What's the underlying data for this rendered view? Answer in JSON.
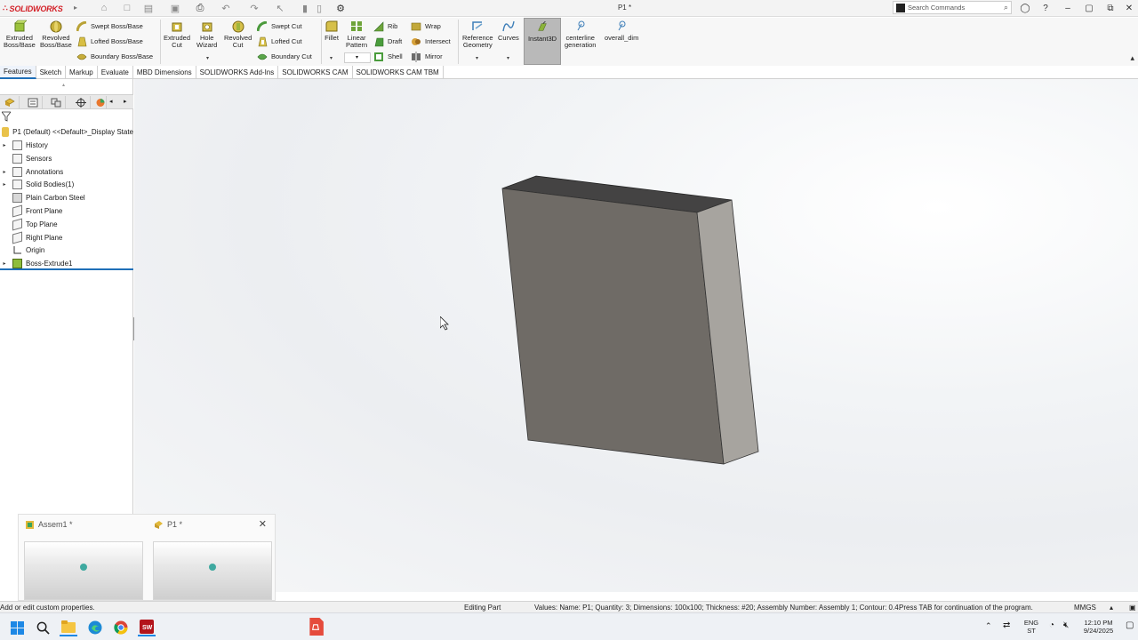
{
  "titlebar": {
    "app_name": "SOLIDWORKS",
    "doc_title": "P1 *",
    "search_placeholder": "Search Commands"
  },
  "ribbon": {
    "extruded_boss": "Extruded\nBoss/Base",
    "revolved_boss": "Revolved\nBoss/Base",
    "swept_boss": "Swept Boss/Base",
    "lofted_boss": "Lofted Boss/Base",
    "boundary_boss": "Boundary Boss/Base",
    "extruded_cut": "Extruded\nCut",
    "hole_wizard": "Hole\nWizard",
    "revolved_cut": "Revolved\nCut",
    "swept_cut": "Swept Cut",
    "lofted_cut": "Lofted Cut",
    "boundary_cut": "Boundary Cut",
    "fillet": "Fillet",
    "linear_pattern": "Linear\nPattern",
    "rib": "Rib",
    "draft": "Draft",
    "shell": "Shell",
    "wrap": "Wrap",
    "intersect": "Intersect",
    "mirror": "Mirror",
    "reference_geometry": "Reference\nGeometry",
    "curves": "Curves",
    "instant3d": "Instant3D",
    "centerline_generation": "centerline\ngeneration",
    "overall_dim": "overall_dim"
  },
  "tabs": [
    "Features",
    "Sketch",
    "Markup",
    "Evaluate",
    "MBD Dimensions",
    "SOLIDWORKS Add-Ins",
    "SOLIDWORKS CAM",
    "SOLIDWORKS CAM TBM"
  ],
  "tree": {
    "root": "P1 (Default) <<Default>_Display State",
    "items": [
      {
        "label": "History",
        "expandable": true
      },
      {
        "label": "Sensors",
        "expandable": false
      },
      {
        "label": "Annotations",
        "expandable": true
      },
      {
        "label": "Solid Bodies(1)",
        "expandable": true
      },
      {
        "label": "Plain Carbon Steel",
        "expandable": false
      },
      {
        "label": "Front Plane",
        "expandable": false
      },
      {
        "label": "Top Plane",
        "expandable": false
      },
      {
        "label": "Right Plane",
        "expandable": false
      },
      {
        "label": "Origin",
        "expandable": false
      },
      {
        "label": "Boss-Extrude1",
        "expandable": true
      }
    ]
  },
  "thumbnails": [
    {
      "title": "Assem1 *"
    },
    {
      "title": "P1 *"
    }
  ],
  "statusbar": {
    "hint": "Add or edit custom properties.",
    "mode": "Editing Part",
    "values": "Values:  Name: P1; Quantity: 3; Dimensions: 100x100; Thickness: #20; Assembly Number: Assembly 1; Contour: 0.4.",
    "tab_hint": "Press TAB for continuation of the program.",
    "units": "MMGS"
  },
  "taskbar": {
    "lang1": "ENG",
    "lang2": "ST",
    "time": "12:10 PM",
    "date": "9/24/2025"
  },
  "colors": {
    "accent": "#1f6fb8",
    "brand": "#d31f26",
    "part_front": "#6f6b66",
    "part_side": "#a7a49f",
    "part_top": "#444343"
  }
}
